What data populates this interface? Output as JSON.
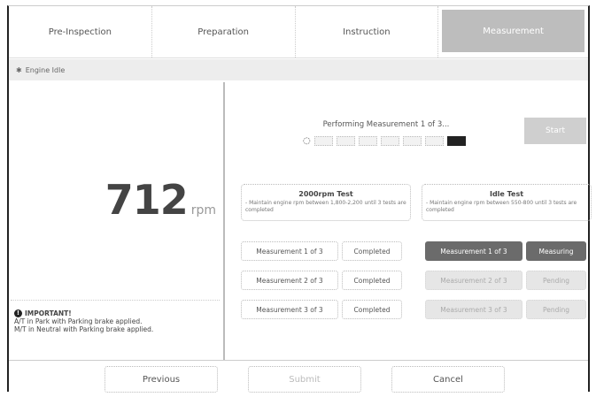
{
  "tabs": [
    {
      "label": "Pre-Inspection",
      "active": false
    },
    {
      "label": "Preparation",
      "active": false
    },
    {
      "label": "Instruction",
      "active": false
    },
    {
      "label": "Measurement",
      "active": true
    }
  ],
  "breadcrumb": {
    "icon": "gear-icon",
    "label": "Engine Idle"
  },
  "rpm": {
    "value": "712",
    "unit": "rpm"
  },
  "note": {
    "icon": "info-icon",
    "title": "IMPORTANT!",
    "lines": [
      "A/T in Park with Parking brake applied.",
      "M/T in Neutral with Parking brake applied."
    ]
  },
  "measurement": {
    "status": "Performing Measurement 1 of 3...",
    "progress_segments": 7,
    "progress_current": 7,
    "start_label": "Start"
  },
  "tests": [
    {
      "title": "2000rpm Test",
      "desc": "- Maintain engine rpm between 1,800-2,200 until 3 tests are completed",
      "rows": [
        {
          "label": "Measurement 1 of 3",
          "status": "Completed",
          "style": "normal"
        },
        {
          "label": "Measurement 2 of 3",
          "status": "Completed",
          "style": "normal"
        },
        {
          "label": "Measurement 3 of 3",
          "status": "Completed",
          "style": "normal"
        }
      ]
    },
    {
      "title": "Idle Test",
      "desc": "- Maintain engine rpm between 550-800 until 3 tests are completed",
      "rows": [
        {
          "label": "Measurement 1 of 3",
          "status": "Measuring",
          "style": "dark"
        },
        {
          "label": "Measurement 2 of 3",
          "status": "Pending",
          "style": "light"
        },
        {
          "label": "Measurement 3 of 3",
          "status": "Pending",
          "style": "light"
        }
      ]
    }
  ],
  "footer": {
    "previous": "Previous",
    "submit": "Submit",
    "cancel": "Cancel"
  }
}
